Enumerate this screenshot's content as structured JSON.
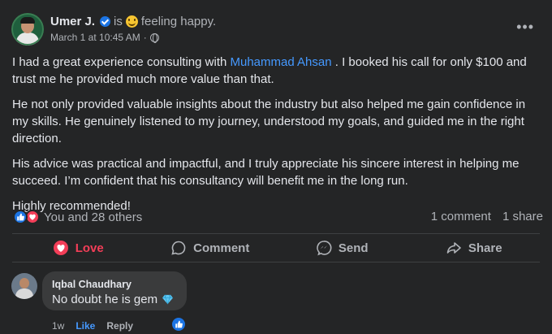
{
  "post": {
    "author": "Umer J.",
    "is_text": "is",
    "feeling": "feeling happy.",
    "timestamp": "March 1 at 10:45 AM",
    "separator": "·",
    "more_label": "•••",
    "body": {
      "p1_before": "I had a great experience consulting with ",
      "mention": "Muhammad Ahsan",
      "p1_after": " . I booked his call for only $100 and trust me he provided much more value than that.",
      "p2": "He not only provided valuable insights about the industry but also helped me gain confidence in my skills. He genuinely listened to my journey, understood my goals, and guided me in the right direction.",
      "p3": "His advice was practical and impactful, and I truly appreciate his sincere interest in helping me succeed. I’m confident that his consultancy will benefit me in the long run.",
      "p4": "Highly recommended!"
    },
    "reactions_text": "You and 28 others",
    "comments_count": "1 comment",
    "shares_count": "1 share",
    "actions": {
      "love": "Love",
      "comment": "Comment",
      "send": "Send",
      "share": "Share"
    },
    "colors": {
      "background": "#242526",
      "love": "#f33e58",
      "link": "#4599ff",
      "like": "#1b74e4"
    }
  },
  "comment": {
    "author": "Iqbal Chaudhary",
    "text": "No doubt he is gem",
    "time": "1w",
    "like_label": "Like",
    "reply_label": "Reply"
  }
}
